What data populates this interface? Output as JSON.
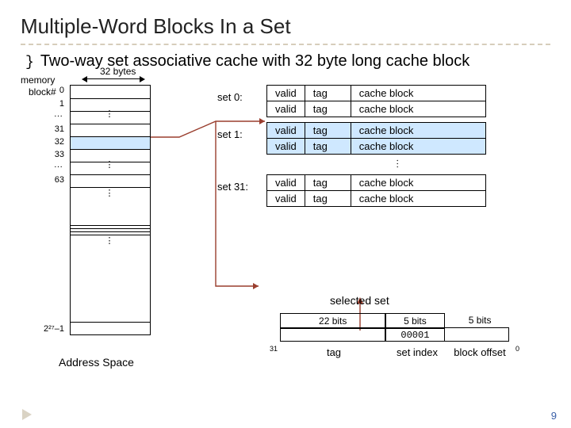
{
  "title": "Multiple-Word Blocks In a Set",
  "intro": "Two-way set associative cache with 32 byte long cache block",
  "memory": {
    "header_small": "memory",
    "block_num_label": "block#",
    "width_label": "32 bytes",
    "row_labels": [
      "0",
      "1",
      "…",
      "31",
      "32",
      "33",
      "…",
      "63"
    ],
    "last_label": "2²⁷–1",
    "caption": "Address Space"
  },
  "cache": {
    "set_labels": [
      "set 0:",
      "set 1:",
      "set 31:"
    ],
    "cols": {
      "valid": "valid",
      "tag": "tag",
      "block": "cache block"
    },
    "selected_set_label": "selected set"
  },
  "address": {
    "bits": [
      "22 bits",
      "5 bits",
      "5 bits"
    ],
    "example_index": "00001",
    "fields": [
      "tag",
      "set index",
      "block offset"
    ],
    "msb": "31",
    "lsb": "0"
  },
  "page_number": "9"
}
